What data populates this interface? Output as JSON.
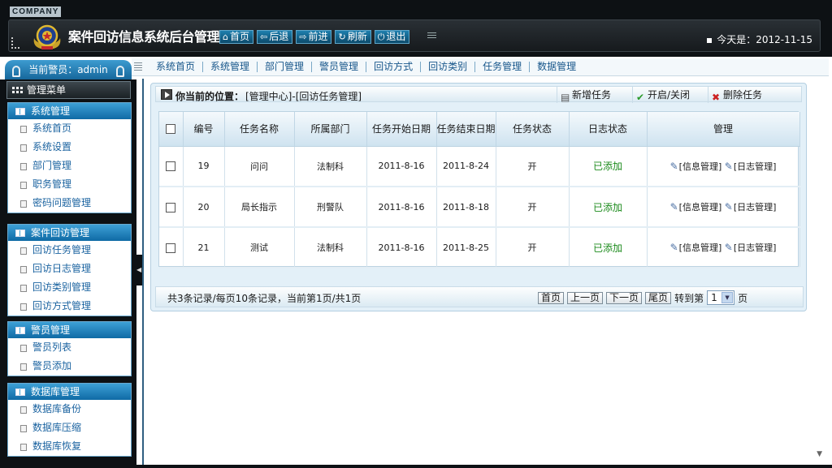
{
  "header": {
    "company": "COMPANY",
    "title": "案件回访信息系统后台管理中心",
    "nav": [
      {
        "label": "首页",
        "icon": "home-icon"
      },
      {
        "label": "后退",
        "icon": "back-arrow-icon"
      },
      {
        "label": "前进",
        "icon": "forward-arrow-icon"
      },
      {
        "label": "刷新",
        "icon": "refresh-icon"
      },
      {
        "label": "退出",
        "icon": "power-icon"
      }
    ],
    "today": "今天是：2012-11-15"
  },
  "admin": {
    "label": "当前警员：admin"
  },
  "topmenu": [
    "系统首页",
    "系统管理",
    "部门管理",
    "警员管理",
    "回访方式",
    "回访类别",
    "任务管理",
    "数据管理"
  ],
  "sidebar": {
    "head": "管理菜单",
    "groups": [
      {
        "title": "系统管理",
        "items": [
          "系统首页",
          "系统设置",
          "部门管理",
          "职务管理",
          "密码问题管理"
        ]
      },
      {
        "title": "案件回访管理",
        "items": [
          "回访任务管理",
          "回访日志管理",
          "回访类别管理",
          "回访方式管理"
        ]
      },
      {
        "title": "警员管理",
        "items": [
          "警员列表",
          "警员添加"
        ]
      },
      {
        "title": "数据库管理",
        "items": [
          "数据库备份",
          "数据库压缩",
          "数据库恢复"
        ]
      }
    ]
  },
  "location": {
    "label": "你当前的位置：",
    "path": "[管理中心]-[回访任务管理]"
  },
  "actions": [
    {
      "label": "新增任务",
      "icon": "add-doc-icon"
    },
    {
      "label": "开启/关闭",
      "icon": "check-icon"
    },
    {
      "label": "删除任务",
      "icon": "delete-icon"
    }
  ],
  "table": {
    "headers": [
      "编号",
      "任务名称",
      "所属部门",
      "任务开始日期",
      "任务结束日期",
      "任务状态",
      "日志状态",
      "管理"
    ],
    "rows": [
      {
        "id": "19",
        "name": "问问",
        "dept": "法制科",
        "start": "2011-8-16",
        "end": "2011-8-24",
        "status": "开",
        "log": "已添加"
      },
      {
        "id": "20",
        "name": "局长指示",
        "dept": "刑警队",
        "start": "2011-8-16",
        "end": "2011-8-18",
        "status": "开",
        "log": "已添加"
      },
      {
        "id": "21",
        "name": "测试",
        "dept": "法制科",
        "start": "2011-8-16",
        "end": "2011-8-25",
        "status": "开",
        "log": "已添加"
      }
    ],
    "info_link": "[信息管理]",
    "log_link": "[日志管理]"
  },
  "pager": {
    "info": "共3条记录/每页10条记录，当前第1页/共1页",
    "first": "首页",
    "prev": "上一页",
    "next": "下一页",
    "last": "尾页",
    "goto": "转到第",
    "page": "1",
    "unit": "页"
  }
}
